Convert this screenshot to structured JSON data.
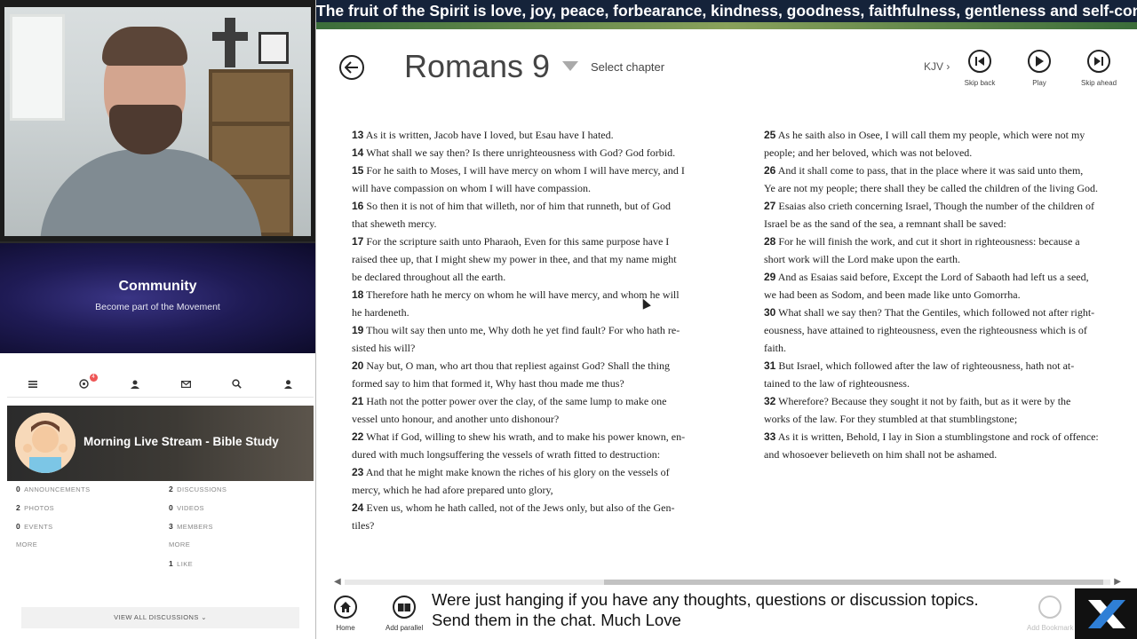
{
  "community": {
    "title": "Community",
    "subtitle": "Become part of the Movement"
  },
  "tabs": {
    "notification_count": "4"
  },
  "stream": {
    "title": "Morning Live Stream - Bible Study"
  },
  "stats": {
    "announcements_count": "0",
    "announcements_label": "ANNOUNCEMENTS",
    "discussions_count": "2",
    "discussions_label": "DISCUSSIONS",
    "photos_count": "2",
    "photos_label": "PHOTOS",
    "videos_count": "0",
    "videos_label": "VIDEOS",
    "events_count": "0",
    "events_label": "EVENTS",
    "members_count": "3",
    "members_label": "MEMBERS",
    "more_left": "MORE",
    "more_right": "MORE",
    "like_count": "1",
    "like_label": "LIKE",
    "view_all": "VIEW ALL DISCUSSIONS ⌄"
  },
  "banner": "The fruit of the Spirit is love, joy, peace, forbearance, kindness, goodness, faithfulness, gentleness and self-control",
  "header": {
    "book_title": "Romans 9",
    "select_chapter": "Select chapter",
    "version": "KJV ›",
    "skip_back": "Skip back",
    "play": "Play",
    "skip_ahead": "Skip ahead"
  },
  "verses_left": [
    {
      "n": "13",
      "lines": [
        "As it is written, Jacob have I loved, but Esau have I hated."
      ]
    },
    {
      "n": "14",
      "lines": [
        "What shall we say then? Is there unrighteousness with God? God forbid."
      ]
    },
    {
      "n": "15",
      "lines": [
        "For he saith to Moses, I will have mercy on whom I will have mercy, and I",
        "will have compassion on whom I will have compassion."
      ]
    },
    {
      "n": "16",
      "lines": [
        "So then it is not of him that willeth, nor of him that runneth, but of God",
        "that sheweth mercy."
      ]
    },
    {
      "n": "17",
      "lines": [
        "For the scripture saith unto Pharaoh, Even for this same purpose have I",
        "raised thee up, that I might shew my power in thee, and that my name might",
        "be declared throughout all the earth."
      ]
    },
    {
      "n": "18",
      "lines": [
        "Therefore hath he mercy on whom he will have mercy, and whom he will",
        "he hardeneth."
      ]
    },
    {
      "n": "19",
      "lines": [
        "Thou wilt say then unto me, Why doth he yet find fault? For who hath re-",
        "sisted his will?"
      ]
    },
    {
      "n": "20",
      "lines": [
        "Nay but, O man, who art thou that repliest against God? Shall the thing",
        "formed say to him that formed it, Why hast thou made me thus?"
      ]
    },
    {
      "n": "21",
      "lines": [
        "Hath not the potter power over the clay, of the same lump to make one",
        "vessel unto honour, and another unto dishonour?"
      ]
    },
    {
      "n": "22",
      "lines": [
        "What if God, willing to shew his wrath, and to make his power known, en-",
        "dured with much longsuffering the vessels of wrath fitted to destruction:"
      ]
    },
    {
      "n": "23",
      "lines": [
        "And that he might make known the riches of his glory on the vessels of",
        "mercy, which he had afore prepared unto glory,"
      ]
    },
    {
      "n": "24",
      "lines": [
        "Even us, whom he hath called, not of the Jews only, but also of the Gen-",
        "tiles?"
      ]
    }
  ],
  "verses_right": [
    {
      "n": "25",
      "lines": [
        "As he saith also in Osee, I will call them my people, which were not my",
        "people; and her beloved, which was not beloved."
      ]
    },
    {
      "n": "26",
      "lines": [
        "And it shall come to pass, that in the place where it was said unto them,",
        "Ye are not my people; there shall they be called the children of the living God."
      ]
    },
    {
      "n": "27",
      "lines": [
        "Esaias also crieth concerning Israel, Though the number of the children of",
        "Israel be as the sand of the sea, a remnant shall be saved:"
      ]
    },
    {
      "n": "28",
      "lines": [
        "For he will finish the work, and cut it short in righteousness: because a",
        "short work will the Lord make upon the earth."
      ]
    },
    {
      "n": "29",
      "lines": [
        "And as Esaias said before, Except the Lord of Sabaoth had left us a seed,",
        "we had been as Sodom, and been made like unto Gomorrha."
      ]
    },
    {
      "n": "30",
      "lines": [
        "What shall we say then? That the Gentiles, which followed not after right-",
        "eousness, have attained to righteousness, even the righteousness which is of",
        "faith."
      ]
    },
    {
      "n": "31",
      "lines": [
        "But Israel, which followed after the law of righteousness, hath not at-",
        "tained to the law of righteousness."
      ]
    },
    {
      "n": "32",
      "lines": [
        "Wherefore? Because they sought it not by faith, but as it were by the",
        "works of the law. For they stumbled at that stumblingstone;"
      ]
    },
    {
      "n": "33",
      "lines": [
        "As it is written, Behold, I lay in Sion a stumblingstone and rock of offence:",
        "and whosoever believeth on him shall not be ashamed."
      ]
    }
  ],
  "bottom": {
    "home": "Home",
    "add_parallel": "Add parallel",
    "chat_line1": "Were just hanging if you have any thoughts, questions or discussion topics.",
    "chat_line2": "Send them in the chat. Much Love",
    "add_bookmark": "Add Bookmark"
  }
}
